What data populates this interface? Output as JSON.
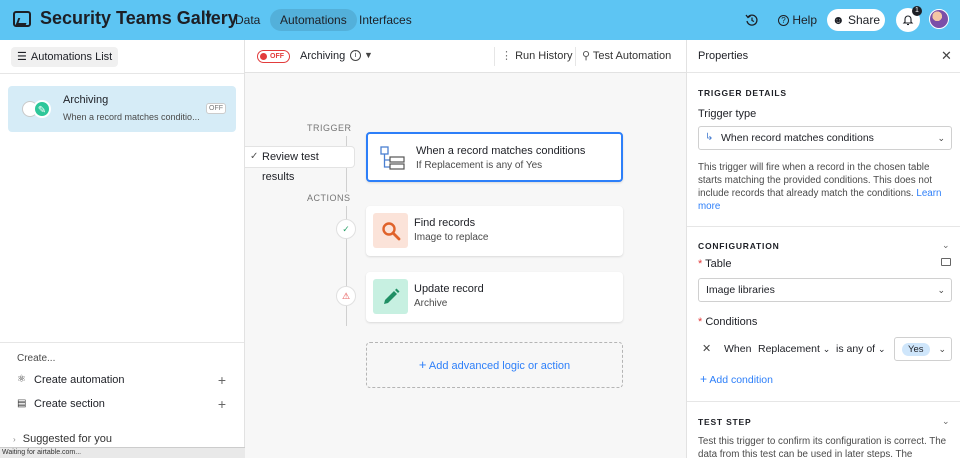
{
  "header": {
    "base_title": "Security Teams Gallery",
    "tabs": [
      {
        "label": "Data",
        "active": false
      },
      {
        "label": "Automations",
        "active": true
      },
      {
        "label": "Interfaces",
        "active": false
      }
    ],
    "help_label": "Help",
    "share_label": "Share",
    "notification_count": "1",
    "accent_color": "#5dc5f3"
  },
  "sidebar": {
    "list_header": "Automations List",
    "automation": {
      "name": "Archiving",
      "description": "When a record matches conditio...",
      "status": "OFF"
    },
    "create_label": "Create...",
    "create_items": [
      {
        "label": "Create automation",
        "icon": "automation-icon"
      },
      {
        "label": "Create section",
        "icon": "section-icon"
      }
    ],
    "suggested_label": "Suggested for you",
    "status_text": "Waiting for airtable.com..."
  },
  "canvas": {
    "toggle_label": "OFF",
    "automation_name": "Archiving",
    "run_history_label": "Run History",
    "test_automation_label": "Test Automation",
    "trigger_label": "TRIGGER",
    "actions_label": "ACTIONS",
    "review_label": "Review test results",
    "trigger": {
      "title": "When a record matches conditions",
      "subtitle": "If Replacement is any of Yes"
    },
    "actions": [
      {
        "title": "Find records",
        "subtitle": "Image to replace",
        "icon": "search-icon",
        "color": "#fbe3d9",
        "status_icon": "check-icon"
      },
      {
        "title": "Update record",
        "subtitle": "Archive",
        "icon": "pencil-icon",
        "color": "#c7f0e1",
        "status_icon": "warning-icon"
      }
    ],
    "add_logic_label": "Add advanced logic or action"
  },
  "panel": {
    "title": "Properties",
    "trigger_details_label": "TRIGGER DETAILS",
    "trigger_type_label": "Trigger type",
    "trigger_type_value": "When record matches conditions",
    "trigger_desc": "This trigger will fire when a record in the chosen table starts matching the provided conditions. This does not include records that already match the conditions.",
    "learn_more": "Learn more",
    "configuration_label": "CONFIGURATION",
    "table_label": "Table",
    "table_value": "Image libraries",
    "conditions_label": "Conditions",
    "condition": {
      "when": "When",
      "field": "Replacement",
      "operator": "is any of",
      "value": "Yes"
    },
    "add_condition_label": "Add condition",
    "test_step_label": "TEST STEP",
    "test_desc": "Test this trigger to confirm its configuration is correct. The data from this test can be used in later steps. The"
  }
}
